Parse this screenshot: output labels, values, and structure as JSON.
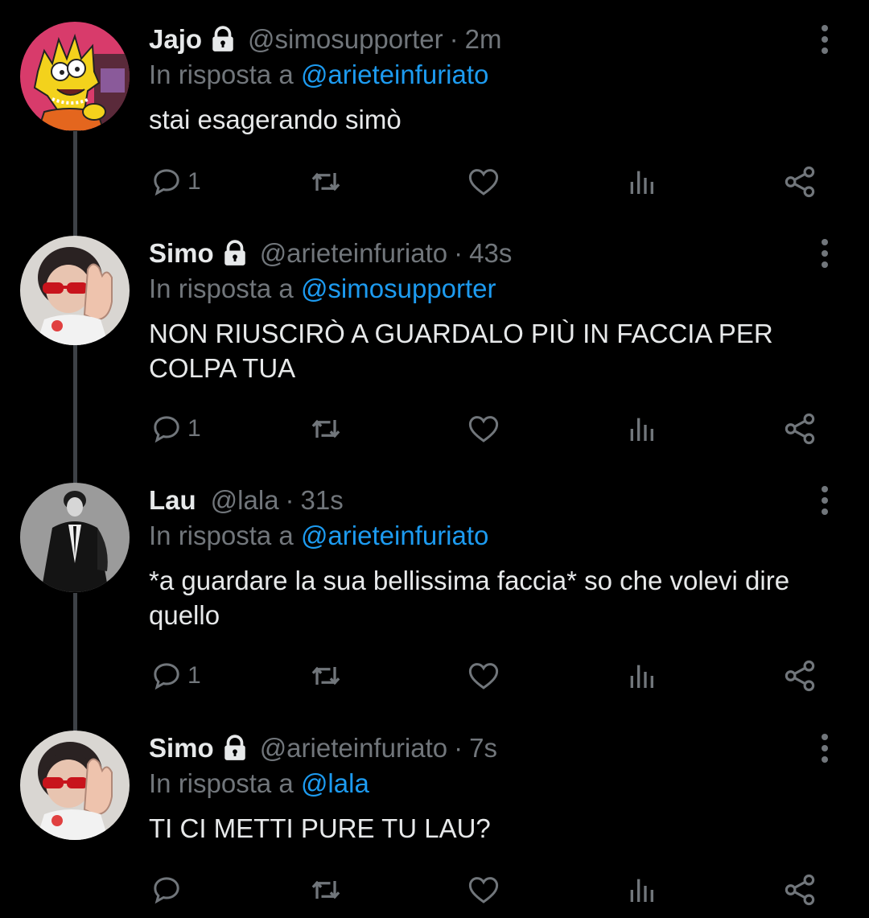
{
  "tweets": [
    {
      "name": "Jajo",
      "handle": "@simosupporter",
      "time": "2m",
      "reply_prefix": "In risposta a",
      "reply_to": "@arieteinfuriato",
      "text": "stai esagerando simò",
      "locked": true,
      "reply_count": "1"
    },
    {
      "name": "Simo",
      "handle": "@arieteinfuriato",
      "time": "43s",
      "reply_prefix": "In risposta a",
      "reply_to": "@simosupporter",
      "text": "NON RIUSCIRÒ A GUARDALO PIÙ IN FACCIA PER COLPA TUA",
      "locked": true,
      "reply_count": "1"
    },
    {
      "name": "Lau",
      "handle": "@lala",
      "time": "31s",
      "reply_prefix": "In risposta a",
      "reply_to": "@arieteinfuriato",
      "text": "*a guardare la sua bellissima faccia* so che volevi dire quello",
      "locked": false,
      "reply_count": "1"
    },
    {
      "name": "Simo",
      "handle": "@arieteinfuriato",
      "time": "7s",
      "reply_prefix": "In risposta a",
      "reply_to": "@lala",
      "text": "TI CI METTI PURE TU LAU?",
      "locked": true,
      "reply_count": ""
    }
  ],
  "separator": "·",
  "icons": {
    "reply": "reply-icon",
    "retweet": "retweet-icon",
    "like": "heart-icon",
    "views": "views-icon",
    "share": "share-icon",
    "more": "more-options-icon",
    "lock": "lock-icon"
  },
  "colors": {
    "background": "#000000",
    "text": "#e7e9ea",
    "secondary": "#71767b",
    "link": "#1d9bf0",
    "thread_line": "#3d4146"
  }
}
